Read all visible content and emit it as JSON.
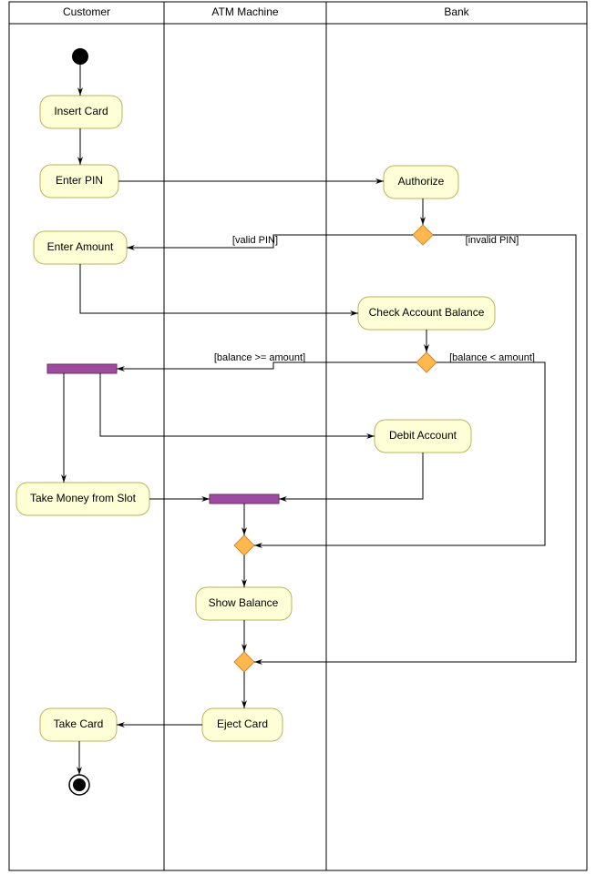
{
  "lanes": {
    "customer": "Customer",
    "atm": "ATM Machine",
    "bank": "Bank"
  },
  "activities": {
    "insert_card": "Insert Card",
    "enter_pin": "Enter PIN",
    "authorize": "Authorize",
    "enter_amount": "Enter Amount",
    "check_balance": "Check Account Balance",
    "debit_account": "Debit Account",
    "take_money": "Take Money from Slot",
    "show_balance": "Show Balance",
    "eject_card": "Eject Card",
    "take_card": "Take Card"
  },
  "guards": {
    "valid_pin": "[valid PIN]",
    "invalid_pin": "[invalid PIN]",
    "balance_ge": "[balance >= amount]",
    "balance_lt": "[balance < amount]"
  },
  "chart_data": {
    "type": "uml-activity-diagram",
    "swimlanes": [
      "Customer",
      "ATM Machine",
      "Bank"
    ],
    "nodes": [
      {
        "id": "start",
        "type": "initial",
        "lane": "Customer"
      },
      {
        "id": "insert_card",
        "type": "activity",
        "lane": "Customer",
        "label": "Insert Card"
      },
      {
        "id": "enter_pin",
        "type": "activity",
        "lane": "Customer",
        "label": "Enter PIN"
      },
      {
        "id": "authorize",
        "type": "activity",
        "lane": "Bank",
        "label": "Authorize"
      },
      {
        "id": "d1",
        "type": "decision",
        "lane": "Bank"
      },
      {
        "id": "enter_amount",
        "type": "activity",
        "lane": "Customer",
        "label": "Enter Amount"
      },
      {
        "id": "check_balance",
        "type": "activity",
        "lane": "Bank",
        "label": "Check Account Balance"
      },
      {
        "id": "d2",
        "type": "decision",
        "lane": "Bank"
      },
      {
        "id": "fork1",
        "type": "fork",
        "lane": "Customer"
      },
      {
        "id": "debit_account",
        "type": "activity",
        "lane": "Bank",
        "label": "Debit Account"
      },
      {
        "id": "take_money",
        "type": "activity",
        "lane": "Customer",
        "label": "Take Money from Slot"
      },
      {
        "id": "join1",
        "type": "join",
        "lane": "ATM Machine"
      },
      {
        "id": "m1",
        "type": "merge",
        "lane": "ATM Machine"
      },
      {
        "id": "show_balance",
        "type": "activity",
        "lane": "ATM Machine",
        "label": "Show Balance"
      },
      {
        "id": "m2",
        "type": "merge",
        "lane": "ATM Machine"
      },
      {
        "id": "eject_card",
        "type": "activity",
        "lane": "ATM Machine",
        "label": "Eject Card"
      },
      {
        "id": "take_card",
        "type": "activity",
        "lane": "Customer",
        "label": "Take Card"
      },
      {
        "id": "end",
        "type": "final",
        "lane": "Customer"
      }
    ],
    "edges": [
      {
        "from": "start",
        "to": "insert_card"
      },
      {
        "from": "insert_card",
        "to": "enter_pin"
      },
      {
        "from": "enter_pin",
        "to": "authorize"
      },
      {
        "from": "authorize",
        "to": "d1"
      },
      {
        "from": "d1",
        "to": "enter_amount",
        "guard": "[valid PIN]"
      },
      {
        "from": "d1",
        "to": "m2",
        "guard": "[invalid PIN]"
      },
      {
        "from": "enter_amount",
        "to": "check_balance"
      },
      {
        "from": "check_balance",
        "to": "d2"
      },
      {
        "from": "d2",
        "to": "fork1",
        "guard": "[balance >= amount]"
      },
      {
        "from": "d2",
        "to": "m1",
        "guard": "[balance < amount]"
      },
      {
        "from": "fork1",
        "to": "debit_account"
      },
      {
        "from": "fork1",
        "to": "take_money"
      },
      {
        "from": "debit_account",
        "to": "join1"
      },
      {
        "from": "take_money",
        "to": "join1"
      },
      {
        "from": "join1",
        "to": "m1"
      },
      {
        "from": "m1",
        "to": "show_balance"
      },
      {
        "from": "show_balance",
        "to": "m2"
      },
      {
        "from": "m2",
        "to": "eject_card"
      },
      {
        "from": "eject_card",
        "to": "take_card"
      },
      {
        "from": "take_card",
        "to": "end"
      }
    ]
  }
}
